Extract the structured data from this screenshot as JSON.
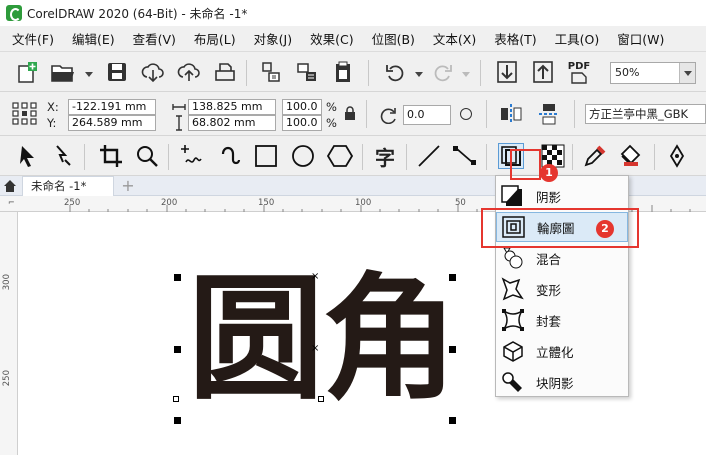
{
  "window": {
    "title": "CorelDRAW 2020 (64-Bit) - 未命名 -1*"
  },
  "menu": [
    "文件(F)",
    "编辑(E)",
    "查看(V)",
    "布局(L)",
    "对象(J)",
    "效果(C)",
    "位图(B)",
    "文本(X)",
    "表格(T)",
    "工具(O)",
    "窗口(W)"
  ],
  "standard_toolbar": {
    "pdf_label": "PDF",
    "zoom_value": "50%"
  },
  "property_bar": {
    "x_label": "X:",
    "x_value": "-122.191 mm",
    "y_label": "Y:",
    "y_value": "264.589 mm",
    "width_value": "138.825 mm",
    "height_value": "68.802 mm",
    "scale_w": "100.0",
    "scale_h": "100.0",
    "percent": "%",
    "rotation_value": "0.0",
    "font_name": "方正兰亭中黑_GBK"
  },
  "toolbox": {
    "text_tool_glyph": "字"
  },
  "document_tabs": {
    "active": "未命名 -1*",
    "add": "+"
  },
  "rulers": {
    "horizontal": [
      "250",
      "200",
      "150",
      "100",
      "50"
    ],
    "vertical": [
      "300",
      "250"
    ]
  },
  "canvas": {
    "text": "圆角"
  },
  "flyout": {
    "items": [
      {
        "label": "阴影",
        "icon": "drop-shadow-icon"
      },
      {
        "label": "輪廓圖",
        "icon": "contour-icon"
      },
      {
        "label": "混合",
        "icon": "blend-icon"
      },
      {
        "label": "变形",
        "icon": "distort-icon"
      },
      {
        "label": "封套",
        "icon": "envelope-icon"
      },
      {
        "label": "立體化",
        "icon": "extrude-icon"
      },
      {
        "label": "块阴影",
        "icon": "block-shadow-icon"
      }
    ]
  },
  "annotations": {
    "badge_1": "1",
    "badge_2": "2",
    "color": "#e5362f"
  }
}
